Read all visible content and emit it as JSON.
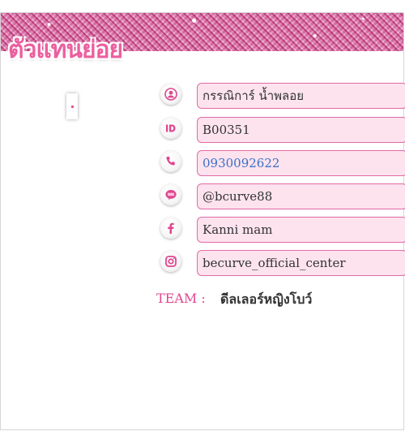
{
  "header": {
    "title": "ตัวแทนย่อย"
  },
  "profile": {
    "fields": [
      {
        "icon": "user-icon",
        "value": "กรรณิการ์  น้ำพลอย"
      },
      {
        "icon": "id-icon",
        "value": "B00351"
      },
      {
        "icon": "phone-icon",
        "value": "0930092622"
      },
      {
        "icon": "line-icon",
        "value": "@bcurve88"
      },
      {
        "icon": "facebook-icon",
        "value": "Kanni mam"
      },
      {
        "icon": "instagram-icon",
        "value": "becurve_official_center"
      }
    ],
    "team_label": "TEAM :",
    "team_value": "ดีลเลอร์หญิงโบว์"
  },
  "colors": {
    "accent": "#e0468f",
    "field_bg": "#fde3ee",
    "field_border": "#e36aa5",
    "phone_link": "#3a6fc7"
  }
}
